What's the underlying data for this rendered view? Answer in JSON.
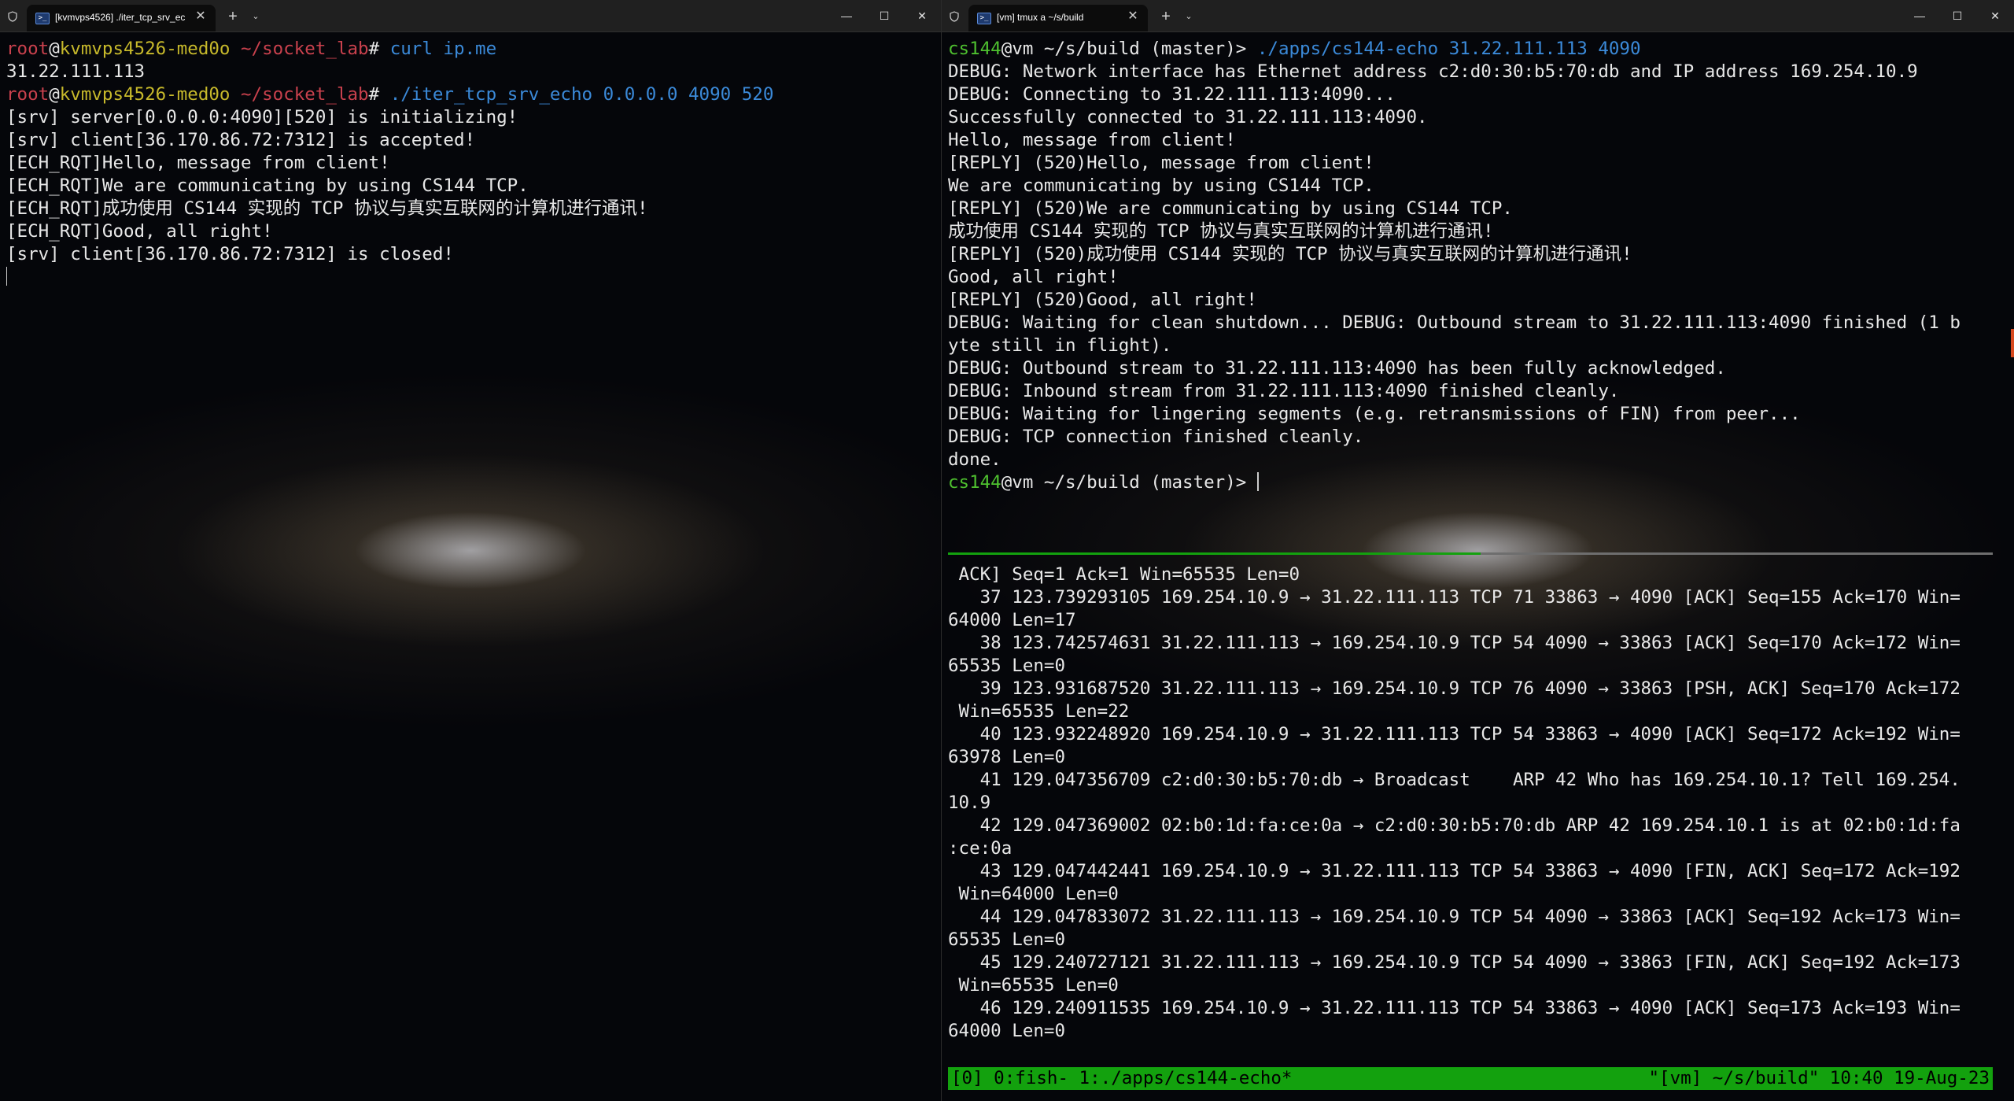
{
  "colors": {
    "prompt_user": "#4ec02f",
    "host": "#c7b92b",
    "path": "#c9414d",
    "command": "#3b8ad9",
    "tmux_status_bg": "#13a10e"
  },
  "left_window": {
    "tab_title": "[kvmvps4526] ./iter_tcp_srv_ec",
    "tab_icon": "terminal-icon",
    "lines": [
      [
        {
          "t": "root",
          "c": "r"
        },
        {
          "t": "@",
          "c": "w"
        },
        {
          "t": "kvmvps4526-med0o ",
          "c": "y"
        },
        {
          "t": "~/socket_lab",
          "c": "r"
        },
        {
          "t": "# ",
          "c": "w"
        },
        {
          "t": "curl ip.me",
          "c": "b"
        }
      ],
      [
        {
          "t": "31.22.111.113",
          "c": "w"
        }
      ],
      [
        {
          "t": "root",
          "c": "r"
        },
        {
          "t": "@",
          "c": "w"
        },
        {
          "t": "kvmvps4526-med0o ",
          "c": "y"
        },
        {
          "t": "~/socket_lab",
          "c": "r"
        },
        {
          "t": "# ",
          "c": "w"
        },
        {
          "t": "./iter_tcp_srv_echo",
          "c": "b"
        },
        {
          "t": " 0.0.0.0 4090 520",
          "c": "b"
        }
      ],
      [
        {
          "t": "[srv] server[0.0.0.0:4090][520] is initializing!",
          "c": "w"
        }
      ],
      [
        {
          "t": "[srv] client[36.170.86.72:7312] is accepted!",
          "c": "w"
        }
      ],
      [
        {
          "t": "[ECH_RQT]Hello, message from client!",
          "c": "w"
        }
      ],
      [
        {
          "t": "[ECH_RQT]We are communicating by using CS144 TCP.",
          "c": "w"
        }
      ],
      [
        {
          "t": "[ECH_RQT]成功使用 CS144 实现的 TCP 协议与真实互联网的计算机进行通讯!",
          "c": "w"
        }
      ],
      [
        {
          "t": "[ECH_RQT]Good, all right!",
          "c": "w"
        }
      ],
      [
        {
          "t": "[srv] client[36.170.86.72:7312] is closed!",
          "c": "w"
        }
      ]
    ]
  },
  "right_window": {
    "tab_title": "[vm] tmux a ~/s/build",
    "tab_icon": "terminal-icon",
    "upper_lines": [
      [
        {
          "t": "cs144",
          "c": "g"
        },
        {
          "t": "@vm ",
          "c": "w"
        },
        {
          "t": "~/s/build ",
          "c": "w"
        },
        {
          "t": "(master)> ",
          "c": "w"
        },
        {
          "t": "./apps/cs144-echo 31.22.111.113 4090",
          "c": "b"
        }
      ],
      [
        {
          "t": "DEBUG: Network interface has Ethernet address c2:d0:30:b5:70:db and IP address 169.254.10.9",
          "c": "w"
        }
      ],
      [
        {
          "t": "DEBUG: Connecting to 31.22.111.113:4090...",
          "c": "w"
        }
      ],
      [
        {
          "t": "Successfully connected to 31.22.111.113:4090.",
          "c": "w"
        }
      ],
      [
        {
          "t": "Hello, message from client!",
          "c": "w"
        }
      ],
      [
        {
          "t": "[REPLY] (520)Hello, message from client!",
          "c": "w"
        }
      ],
      [
        {
          "t": "We are communicating by using CS144 TCP.",
          "c": "w"
        }
      ],
      [
        {
          "t": "[REPLY] (520)We are communicating by using CS144 TCP.",
          "c": "w"
        }
      ],
      [
        {
          "t": "成功使用 CS144 实现的 TCP 协议与真实互联网的计算机进行通讯!",
          "c": "w"
        }
      ],
      [
        {
          "t": "[REPLY] (520)成功使用 CS144 实现的 TCP 协议与真实互联网的计算机进行通讯!",
          "c": "w"
        }
      ],
      [
        {
          "t": "Good, all right!",
          "c": "w"
        }
      ],
      [
        {
          "t": "[REPLY] (520)Good, all right!",
          "c": "w"
        }
      ],
      [
        {
          "t": "DEBUG: Waiting for clean shutdown... DEBUG: Outbound stream to 31.22.111.113:4090 finished (1 b",
          "c": "w"
        }
      ],
      [
        {
          "t": "yte still in flight).",
          "c": "w"
        }
      ],
      [
        {
          "t": "DEBUG: Outbound stream to 31.22.111.113:4090 has been fully acknowledged.",
          "c": "w"
        }
      ],
      [
        {
          "t": "DEBUG: Inbound stream from 31.22.111.113:4090 finished cleanly.",
          "c": "w"
        }
      ],
      [
        {
          "t": "DEBUG: Waiting for lingering segments (e.g. retransmissions of FIN) from peer...",
          "c": "w"
        }
      ],
      [
        {
          "t": "DEBUG: TCP connection finished cleanly.",
          "c": "w"
        }
      ],
      [
        {
          "t": "done.",
          "c": "w"
        }
      ],
      [
        {
          "t": "cs144",
          "c": "g"
        },
        {
          "t": "@vm ",
          "c": "w"
        },
        {
          "t": "~/s/build ",
          "c": "w"
        },
        {
          "t": "(master)> ",
          "c": "w"
        }
      ]
    ],
    "lower_lines": [
      [
        {
          "t": " ACK] Seq=1 Ack=1 Win=65535 Len=0",
          "c": "w"
        }
      ],
      [
        {
          "t": "   37 123.739293105 169.254.10.9 → 31.22.111.113 TCP 71 33863 → 4090 [ACK] Seq=155 Ack=170 Win=",
          "c": "w"
        }
      ],
      [
        {
          "t": "64000 Len=17",
          "c": "w"
        }
      ],
      [
        {
          "t": "   38 123.742574631 31.22.111.113 → 169.254.10.9 TCP 54 4090 → 33863 [ACK] Seq=170 Ack=172 Win=",
          "c": "w"
        }
      ],
      [
        {
          "t": "65535 Len=0",
          "c": "w"
        }
      ],
      [
        {
          "t": "   39 123.931687520 31.22.111.113 → 169.254.10.9 TCP 76 4090 → 33863 [PSH, ACK] Seq=170 Ack=172",
          "c": "w"
        }
      ],
      [
        {
          "t": " Win=65535 Len=22",
          "c": "w"
        }
      ],
      [
        {
          "t": "   40 123.932248920 169.254.10.9 → 31.22.111.113 TCP 54 33863 → 4090 [ACK] Seq=172 Ack=192 Win=",
          "c": "w"
        }
      ],
      [
        {
          "t": "63978 Len=0",
          "c": "w"
        }
      ],
      [
        {
          "t": "   41 129.047356709 c2:d0:30:b5:70:db → Broadcast    ARP 42 Who has 169.254.10.1? Tell 169.254.",
          "c": "w"
        }
      ],
      [
        {
          "t": "10.9",
          "c": "w"
        }
      ],
      [
        {
          "t": "   42 129.047369002 02:b0:1d:fa:ce:0a → c2:d0:30:b5:70:db ARP 42 169.254.10.1 is at 02:b0:1d:fa",
          "c": "w"
        }
      ],
      [
        {
          "t": ":ce:0a",
          "c": "w"
        }
      ],
      [
        {
          "t": "   43 129.047442441 169.254.10.9 → 31.22.111.113 TCP 54 33863 → 4090 [FIN, ACK] Seq=172 Ack=192",
          "c": "w"
        }
      ],
      [
        {
          "t": " Win=64000 Len=0",
          "c": "w"
        }
      ],
      [
        {
          "t": "   44 129.047833072 31.22.111.113 → 169.254.10.9 TCP 54 4090 → 33863 [ACK] Seq=192 Ack=173 Win=",
          "c": "w"
        }
      ],
      [
        {
          "t": "65535 Len=0",
          "c": "w"
        }
      ],
      [
        {
          "t": "   45 129.240727121 31.22.111.113 → 169.254.10.9 TCP 54 4090 → 33863 [FIN, ACK] Seq=192 Ack=173",
          "c": "w"
        }
      ],
      [
        {
          "t": " Win=65535 Len=0",
          "c": "w"
        }
      ],
      [
        {
          "t": "   46 129.240911535 169.254.10.9 → 31.22.111.113 TCP 54 33863 → 4090 [ACK] Seq=173 Ack=193 Win=",
          "c": "w"
        }
      ],
      [
        {
          "t": "64000 Len=0",
          "c": "w"
        }
      ]
    ],
    "tmux_status_left": "[0] 0:fish- 1:./apps/cs144-echo*",
    "tmux_status_right": "\"[vm] ~/s/build\" 10:40 19-Aug-23"
  },
  "window_buttons": {
    "minimize": "—",
    "maximize": "☐",
    "close": "✕",
    "tab_close": "✕",
    "new_tab": "+",
    "tab_dropdown": "⌄"
  }
}
